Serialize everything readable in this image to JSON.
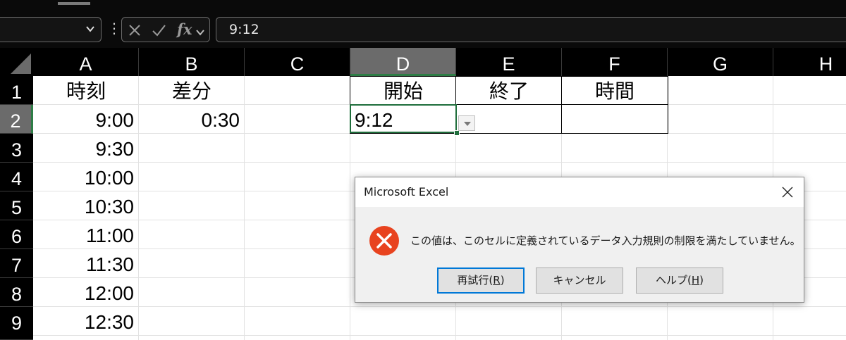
{
  "formula_bar": {
    "name_box": "",
    "formula_value": "9:12",
    "cancel_icon": "x-icon",
    "confirm_icon": "check-icon",
    "fx_label": "fx"
  },
  "sheet": {
    "columns": [
      "A",
      "B",
      "C",
      "D",
      "E",
      "F",
      "G",
      "H"
    ],
    "selected_column": "D",
    "rows": [
      "1",
      "2",
      "3",
      "4",
      "5",
      "6",
      "7",
      "8",
      "9"
    ],
    "selected_row": "2",
    "cells": {
      "A1": "時刻",
      "B1": "差分",
      "D1": "開始",
      "E1": "終了",
      "F1": "時間",
      "A2": "9:00",
      "B2": "0:30",
      "D2": "9:12",
      "A3": "9:30",
      "A4": "10:00",
      "A5": "10:30",
      "A6": "11:00",
      "A7": "11:30",
      "A8": "12:00",
      "A9": "12:30"
    }
  },
  "dialog": {
    "title": "Microsoft Excel",
    "message": "この値は、このセルに定義されているデータ入力規則の制限を満たしていません。",
    "icon": "error-icon",
    "buttons": {
      "retry": {
        "label": "再試行(",
        "key": "R",
        "suffix": ")"
      },
      "cancel": {
        "label": "キャンセル"
      },
      "help": {
        "label": "ヘルプ(",
        "key": "H",
        "suffix": ")"
      }
    },
    "error_color": "#e8431f"
  }
}
